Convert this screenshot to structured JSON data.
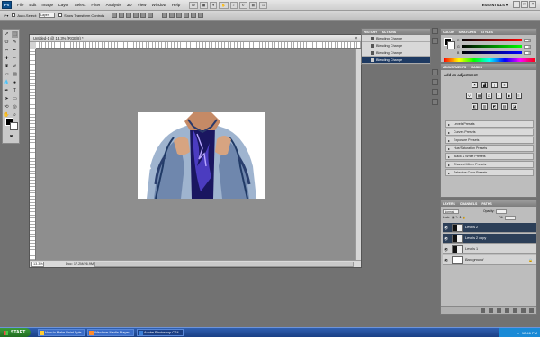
{
  "app": {
    "logo": "Ps",
    "menus": [
      "File",
      "Edit",
      "Image",
      "Layer",
      "Select",
      "Filter",
      "Analysis",
      "3D",
      "View",
      "Window",
      "Help"
    ],
    "workspace": "ESSENTIALS ▾"
  },
  "options_bar": {
    "auto_select_label": "Auto-Select:",
    "auto_select_value": "Layer",
    "transform_label": "Show Transform Controls"
  },
  "document": {
    "title": "Untitled-1 @ 13.3% (RGB/8) *",
    "zoom": "13.3%",
    "doc_info": "Doc: 17.2M/26.9M"
  },
  "history": {
    "tabs": [
      "HISTORY",
      "ACTIONS"
    ],
    "items": [
      "Blending Change",
      "Blending Change",
      "Blending Change",
      "Blending Change"
    ]
  },
  "color_panel": {
    "tabs": [
      "COLOR",
      "SWATCHES",
      "STYLES"
    ],
    "channels": [
      {
        "label": "R",
        "value": "0"
      },
      {
        "label": "G",
        "value": "0"
      },
      {
        "label": "B",
        "value": "0"
      }
    ]
  },
  "adjustments": {
    "tabs": [
      "ADJUSTMENTS",
      "MASKS"
    ],
    "title": "Add an adjustment",
    "presets": [
      "Levels Presets",
      "Curves Presets",
      "Exposure Presets",
      "Hue/Saturation Presets",
      "Black & White Presets",
      "Channel Mixer Presets",
      "Selective Color Presets"
    ]
  },
  "layers": {
    "tabs": [
      "LAYERS",
      "CHANNELS",
      "PATHS"
    ],
    "blend_mode": "Normal",
    "opacity_label": "Opacity:",
    "fill_label": "Fill:",
    "lock_label": "Lock:",
    "items": [
      {
        "name": "Levels 2",
        "selected": true
      },
      {
        "name": "Levels 2 copy",
        "selected": true
      },
      {
        "name": "Levels 1",
        "selected": false
      },
      {
        "name": "Background",
        "selected": false
      }
    ]
  },
  "taskbar": {
    "start": "START",
    "tasks": [
      "How to Make Paint Sple...",
      "Windows Media Player",
      "Adobe Photoshop CS4 ..."
    ],
    "clock": "12:46 PM"
  }
}
